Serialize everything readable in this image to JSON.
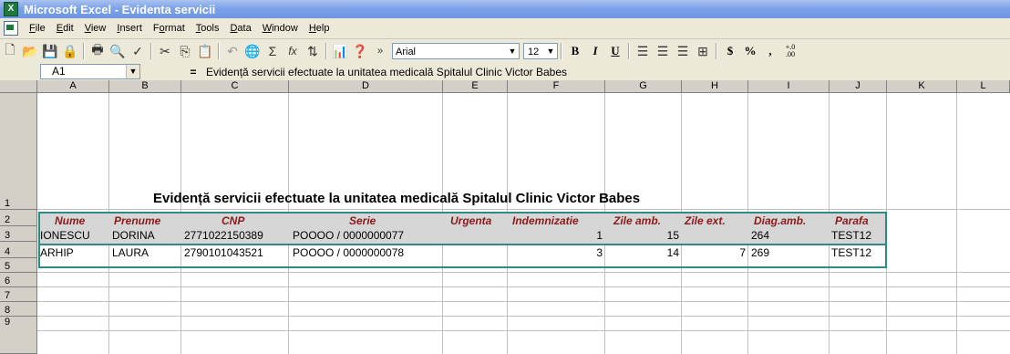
{
  "window": {
    "title": "Microsoft Excel - Evidenta servicii"
  },
  "menu": [
    {
      "ul": "F",
      "rest": "ile"
    },
    {
      "ul": "E",
      "rest": "dit"
    },
    {
      "ul": "V",
      "rest": "iew"
    },
    {
      "ul": "I",
      "rest": "nsert"
    },
    {
      "ul": "F",
      "rest": "ormat",
      "pre": ""
    },
    {
      "ul": "T",
      "rest": "ools"
    },
    {
      "ul": "D",
      "rest": "ata"
    },
    {
      "ul": "W",
      "rest": "indow"
    },
    {
      "ul": "H",
      "rest": "elp"
    }
  ],
  "toolbar": {
    "font": "Arial",
    "size": "12",
    "bold": "B",
    "italic": "I",
    "underline": "U",
    "currency": "$",
    "percent": "%",
    "comma": ",",
    "decimal": "+.0\n.00"
  },
  "formula_bar": {
    "cell_ref": "A1",
    "equals": "=",
    "content": "Evidență servicii efectuate la unitatea medicală Spitalul Clinic Victor Babes"
  },
  "columns": [
    "A",
    "B",
    "C",
    "D",
    "E",
    "F",
    "G",
    "H",
    "I",
    "J",
    "K",
    "L"
  ],
  "rows": [
    "1",
    "2",
    "3",
    "4",
    "5",
    "6",
    "7",
    "8",
    "9"
  ],
  "sheet": {
    "title": "Evidență servicii efectuate la unitatea medicală Spitalul Clinic Victor Babes",
    "headers": [
      "Nume",
      "Prenume",
      "CNP",
      "Serie",
      "Urgenta",
      "Indemnizatie",
      "Zile amb.",
      "Zile ext.",
      "Diag.amb.",
      "Parafa"
    ],
    "records": [
      {
        "nume": "IONESCU",
        "prenume": "DORINA",
        "cnp": "2771022150389",
        "serie": "POOOO / 0000000077",
        "urgenta": "",
        "indemnizatie": "1",
        "zile_amb": "15",
        "zile_ext": "",
        "diag": "264",
        "parafa": "TEST12"
      },
      {
        "nume": "ARHIP",
        "prenume": "LAURA",
        "cnp": "2790101043521",
        "serie": "POOOO / 0000000078",
        "urgenta": "",
        "indemnizatie": "3",
        "zile_amb": "14",
        "zile_ext": "7",
        "diag": "269",
        "parafa": "TEST12"
      }
    ]
  }
}
